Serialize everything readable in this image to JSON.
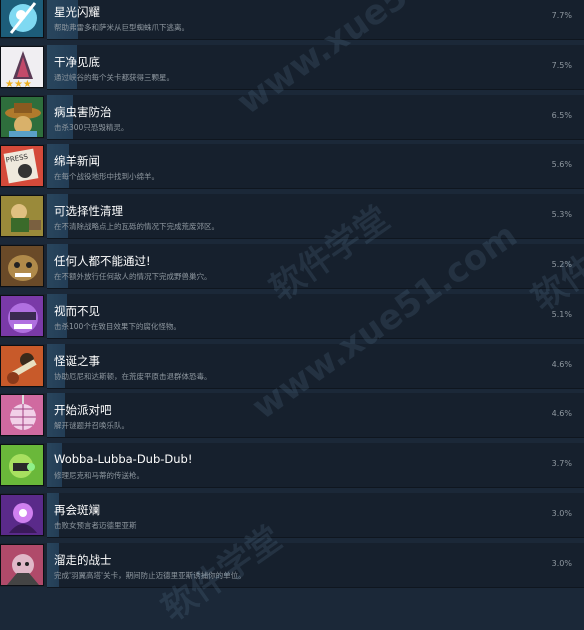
{
  "achievements": [
    {
      "title": "星光闪耀",
      "description": "帮助弗雷多和萨米从巨型蜘蛛爪下逃离。",
      "percent": "7.7%",
      "unlock_fraction": 0.077,
      "icon": "starlight-sword-icon"
    },
    {
      "title": "干净见底",
      "description": "通过峡谷的每个关卡都获得三颗星。",
      "percent": "7.5%",
      "unlock_fraction": 0.075,
      "icon": "three-stars-tower-icon"
    },
    {
      "title": "病虫害防治",
      "description": "击杀300只恐毁精灵。",
      "percent": "6.5%",
      "unlock_fraction": 0.065,
      "icon": "pest-hat-icon"
    },
    {
      "title": "绵羊新闻",
      "description": "在每个战役地形中找到小绵羊。",
      "percent": "5.6%",
      "unlock_fraction": 0.056,
      "icon": "press-sheep-icon"
    },
    {
      "title": "可选择性清理",
      "description": "在不清除战略点上的瓦砾的情况下完成荒废郊区。",
      "percent": "5.3%",
      "unlock_fraction": 0.053,
      "icon": "dwarf-rubble-icon"
    },
    {
      "title": "任何人都不能通过!",
      "description": "在不额外放行任何敌人的情况下完成野兽巢穴。",
      "percent": "5.2%",
      "unlock_fraction": 0.052,
      "icon": "beast-den-icon"
    },
    {
      "title": "视而不见",
      "description": "击杀100个在致目效果下的腐化怪物。",
      "percent": "5.1%",
      "unlock_fraction": 0.051,
      "icon": "blind-monster-icon"
    },
    {
      "title": "怪诞之事",
      "description": "协助厄尼和达斯顿，在荒废平原击退群体恐毒。",
      "percent": "4.6%",
      "unlock_fraction": 0.046,
      "icon": "guitar-hero-icon"
    },
    {
      "title": "开始派对吧",
      "description": "解开谜题并召唤乐队。",
      "percent": "4.6%",
      "unlock_fraction": 0.046,
      "icon": "disco-ball-icon"
    },
    {
      "title": "Wobba-Lubba-Dub-Dub!",
      "description": "修理尼克和马蒂的传送枪。",
      "percent": "3.7%",
      "unlock_fraction": 0.037,
      "icon": "portal-gun-icon"
    },
    {
      "title": "再会斑斓",
      "description": "击败女预言者迈德里亚斯",
      "percent": "3.0%",
      "unlock_fraction": 0.03,
      "icon": "seeress-icon"
    },
    {
      "title": "溜走的战士",
      "description": "完成'羽翼高塔'关卡，期间防止迈德里亚斯诱捕你的单位。",
      "percent": "3.0%",
      "unlock_fraction": 0.03,
      "icon": "warrior-cat-icon"
    }
  ],
  "watermark": {
    "site": "www.xue51.com",
    "brand": "软件学堂"
  },
  "colors": {
    "title": "#ffffff",
    "description": "#8f98a0",
    "progress_bar": "#2b4a63",
    "background": "#1b2838"
  }
}
